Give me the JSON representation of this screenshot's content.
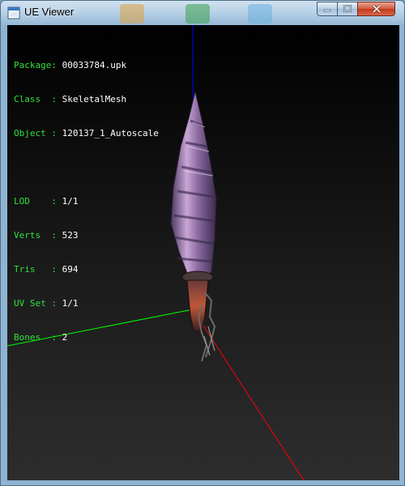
{
  "window": {
    "title": "UE Viewer",
    "controls": {
      "minimize_icon": "minimize-icon",
      "maximize_icon": "maximize-icon",
      "close_icon": "close-icon"
    }
  },
  "info": {
    "package": {
      "label": "Package: ",
      "value": "00033784.upk"
    },
    "class": {
      "label": "Class  : ",
      "value": "SkeletalMesh"
    },
    "object": {
      "label": "Object : ",
      "value": "120137_1_Autoscale"
    },
    "lod": {
      "label": "LOD    : ",
      "value": "1/1"
    },
    "verts": {
      "label": "Verts  : ",
      "value": "523"
    },
    "tris": {
      "label": "Tris   : ",
      "value": "694"
    },
    "uvset": {
      "label": "UV Set : ",
      "value": "1/1"
    },
    "bones": {
      "label": "Bones  : ",
      "value": "2"
    }
  },
  "colors": {
    "label_green": "#2fe13a",
    "axis_x": "#ff0000",
    "axis_y": "#00ff00",
    "axis_z": "#0000ff"
  }
}
